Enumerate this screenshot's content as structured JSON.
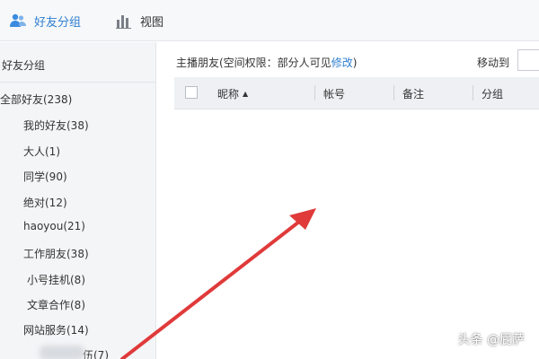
{
  "toolbar": {
    "group_label": "好友分组",
    "view_label": "视图",
    "accent": "#2f7fd0"
  },
  "sidebar": {
    "title": "好友分组",
    "groups": [
      {
        "label": "全部好友(238)"
      },
      {
        "label": "我的好友(38)"
      },
      {
        "label": "大人(1)"
      },
      {
        "label": "同学(90)"
      },
      {
        "label": "绝对(12)"
      },
      {
        "label": "haoyou(21)"
      },
      {
        "label": "工作朋友(38)"
      },
      {
        "label": "小号挂机(8)"
      },
      {
        "label": "文章合作(8)"
      },
      {
        "label": "网站服务(14)"
      },
      {
        "label": "伍(7)"
      }
    ]
  },
  "main": {
    "header_prefix": "主播朋友(空间权限：部分人可见",
    "edit_link": "修改",
    "header_suffix": ")",
    "move_to_label": "移动到",
    "columns": [
      "昵称",
      "帐号",
      "备注",
      "分组"
    ],
    "sort_indicator": "▲"
  },
  "overlay": {
    "watermark": "头条 @屁萨",
    "arrow_color": "#e03a3a"
  }
}
